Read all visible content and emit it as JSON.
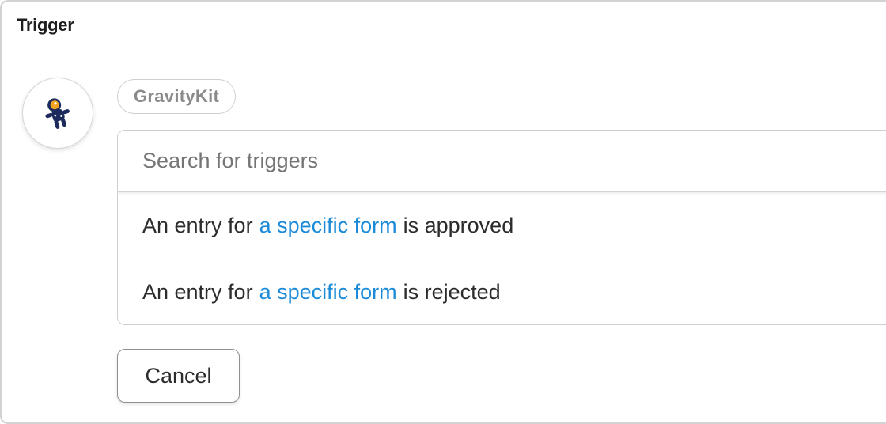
{
  "header": {
    "title": "Trigger"
  },
  "app": {
    "icon": "astronaut-icon",
    "name": "GravityKit"
  },
  "search": {
    "placeholder": "Search for triggers",
    "value": ""
  },
  "triggers": [
    {
      "prefix": "An entry for",
      "link": "a specific form",
      "suffix": "is approved"
    },
    {
      "prefix": "An entry for",
      "link": "a specific form",
      "suffix": "is rejected"
    }
  ],
  "actions": {
    "cancel_label": "Cancel"
  },
  "colors": {
    "link": "#1b8ad8",
    "border": "#cfcfcf",
    "text": "#1e1e1e"
  }
}
